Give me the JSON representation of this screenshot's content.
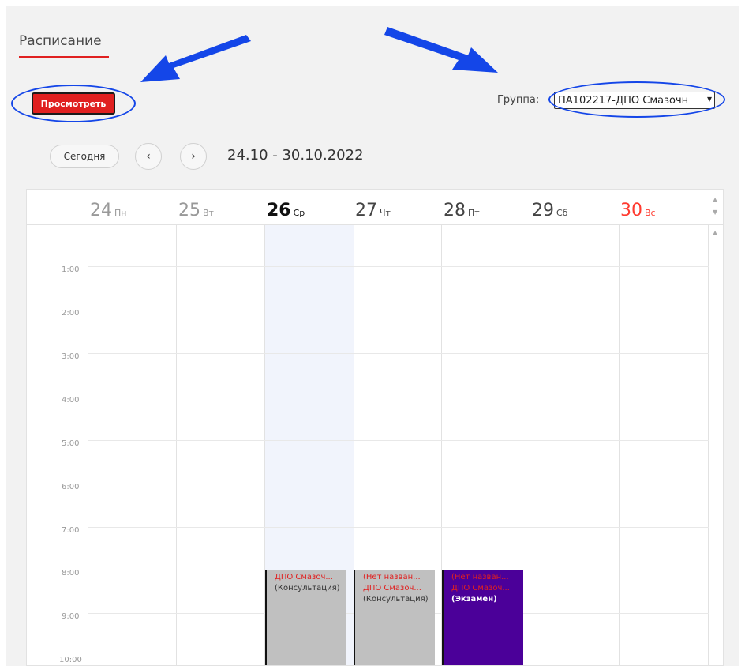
{
  "page": {
    "title": "Расписание"
  },
  "toolbar": {
    "view_label": "Просмотреть"
  },
  "group": {
    "label": "Группа:",
    "selected": "ПА102217-ДПО Смазочн"
  },
  "navigation": {
    "today_label": "Сегодня",
    "prev_symbol": "‹",
    "next_symbol": "›",
    "date_range": "24.10 - 30.10.2022"
  },
  "days": [
    {
      "num": "24",
      "name": "Пн"
    },
    {
      "num": "25",
      "name": "Вт"
    },
    {
      "num": "26",
      "name": "Ср"
    },
    {
      "num": "27",
      "name": "Чт"
    },
    {
      "num": "28",
      "name": "Пт"
    },
    {
      "num": "29",
      "name": "Сб"
    },
    {
      "num": "30",
      "name": "Вс"
    }
  ],
  "times": [
    "1:00",
    "2:00",
    "3:00",
    "4:00",
    "5:00",
    "6:00",
    "7:00",
    "8:00",
    "9:00",
    "10:00"
  ],
  "events": [
    {
      "day": "26",
      "line1": "ДПО Смазоч...",
      "line2": "(Консультация)"
    },
    {
      "day": "27",
      "line1": "(Нет назван...",
      "line2": "ДПО Смазоч...",
      "line3": "(Консультация)"
    },
    {
      "day": "28",
      "line1": "(Нет назван...",
      "line2": "ДПО Смазоч...",
      "line3": "(Экзамен)"
    }
  ],
  "colors": {
    "accent_red": "#e02020",
    "annotation_blue": "#1446e8",
    "event_gray": "#c0c0c0",
    "event_purple": "#4b0099",
    "sunday_red": "#ff3b30"
  },
  "icons": {
    "dropdown": "chevron-down-icon",
    "prev": "chevron-left-icon",
    "next": "chevron-right-icon"
  }
}
